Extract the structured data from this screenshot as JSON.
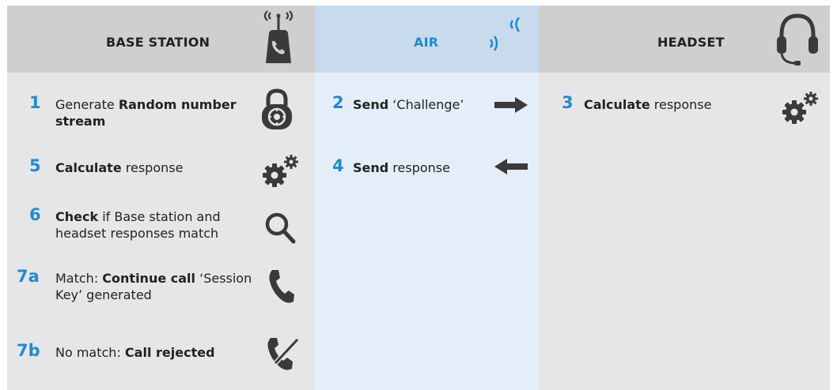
{
  "headers": {
    "base_station": "BASE STATION",
    "air": "AIR",
    "headset": "HEADSET"
  },
  "steps": {
    "s1": {
      "num": "1",
      "pre": "Generate ",
      "bold": "Random number stream",
      "post": ""
    },
    "s2": {
      "num": "2",
      "pre": "",
      "bold": "Send",
      "post": " ‘Challenge’"
    },
    "s3": {
      "num": "3",
      "pre": "",
      "bold": "Calculate",
      "post": " response"
    },
    "s4": {
      "num": "4",
      "pre": "",
      "bold": "Send",
      "post": " response"
    },
    "s5": {
      "num": "5",
      "pre": "",
      "bold": "Calculate",
      "post": " response"
    },
    "s6": {
      "num": "6",
      "pre": "",
      "bold": "Check",
      "post": " if Base station and headset responses match"
    },
    "s7a": {
      "num": "7a",
      "pre": "Match: ",
      "bold": "Continue call",
      "post": " ‘Session Key’ generated"
    },
    "s7b": {
      "num": "7b",
      "pre": "No match:  ",
      "bold": "Call rejected",
      "post": ""
    }
  },
  "icons": {
    "base_station": "base-station-phone-icon",
    "air": "wireless-signal-icon",
    "headset": "headset-icon",
    "s1": "padlock-icon",
    "s2": "arrow-right-icon",
    "s3": "gears-icon",
    "s4": "arrow-left-icon",
    "s5": "gears-icon",
    "s6": "magnifier-icon",
    "s7a": "phone-handset-icon",
    "s7b": "phone-rejected-icon"
  },
  "colors": {
    "accent_blue": "#1e8ad6",
    "icon_dark": "#3a3a3a",
    "panel_gray": "#e6e6e6",
    "panel_blue": "#e3eef8"
  }
}
